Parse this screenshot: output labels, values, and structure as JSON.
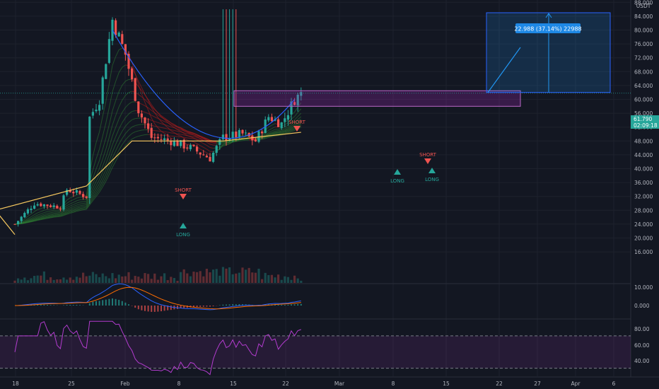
{
  "price_axis": {
    "currency": "USDT",
    "ticks": [
      "88.000",
      "84.000",
      "80.000",
      "76.000",
      "72.000",
      "68.000",
      "64.000",
      "60.000",
      "56.000",
      "52.000",
      "48.000",
      "44.000",
      "40.000",
      "36.000",
      "32.000",
      "28.000",
      "24.000",
      "20.000",
      "16.000"
    ]
  },
  "current_price": {
    "price": "61.790",
    "countdown": "02:09:18"
  },
  "macd_axis": {
    "ticks": [
      "10.000",
      "0.000"
    ]
  },
  "rsi_axis": {
    "ticks": [
      "80.00",
      "60.00",
      "40.00"
    ]
  },
  "time_axis": {
    "ticks": [
      "18",
      "25",
      "Feb",
      "8",
      "15",
      "22",
      "Mar",
      "8",
      "15",
      "22",
      "27",
      "Apr",
      "6"
    ]
  },
  "signals": [
    {
      "label": "SHORT",
      "kind": "short"
    },
    {
      "label": "LONG",
      "kind": "long"
    },
    {
      "label": "SHORT",
      "kind": "short"
    },
    {
      "label": "LONG",
      "kind": "long"
    },
    {
      "label": "SHORT",
      "kind": "short"
    },
    {
      "label": "LONG",
      "kind": "long"
    }
  ],
  "projection": {
    "label": "22.988 (37.14%) 22988"
  },
  "colors": {
    "bg": "#131722",
    "grid": "#1e222d",
    "text": "#b2b5be",
    "up": "#26a69a",
    "down": "#ef5350",
    "ma": "#f6c85f",
    "arc": "#2962ff",
    "box": "#9c27b0",
    "rsi": "#b43cd0",
    "macd": "#2962ff",
    "signal": "#ff6d00",
    "price_tag": "#26a69a",
    "projection": "#2196f3"
  },
  "chart_data": {
    "type": "candlestick",
    "symbol_quote": "USDT",
    "ylim": [
      14,
      92
    ],
    "price_path": [
      {
        "t": "Jan 18",
        "close": 24
      },
      {
        "t": "Jan 21",
        "close": 30
      },
      {
        "t": "Jan 25",
        "close": 29
      },
      {
        "t": "Jan 26",
        "close": 34
      },
      {
        "t": "Jan 29",
        "close": 32
      },
      {
        "t": "Feb 1",
        "close": 34
      },
      {
        "t": "Feb 5",
        "close": 35
      },
      {
        "t": "Feb 8",
        "close": 33
      },
      {
        "t": "Feb 10",
        "close": 44
      },
      {
        "t": "Feb 12",
        "close": 48
      },
      {
        "t": "Feb 15",
        "close": 53
      },
      {
        "t": "Feb 17",
        "close": 60
      },
      {
        "t": "Feb 19",
        "close": 83
      },
      {
        "t": "Feb 21",
        "close": 73
      },
      {
        "t": "Feb 23",
        "close": 57
      },
      {
        "t": "Feb 25",
        "close": 49
      },
      {
        "t": "Feb 28",
        "close": 48
      },
      {
        "t": "Mar 3",
        "close": 46
      },
      {
        "t": "Mar 6",
        "close": 43
      },
      {
        "t": "Mar 8",
        "close": 49
      },
      {
        "t": "Mar 11",
        "close": 50
      },
      {
        "t": "Mar 13",
        "close": 48
      },
      {
        "t": "Mar 15",
        "close": 55
      },
      {
        "t": "Mar 17",
        "close": 53
      },
      {
        "t": "Mar 19",
        "close": 60
      },
      {
        "t": "Mar 20",
        "close": 61.79
      }
    ],
    "moving_average": [
      {
        "t": "Jan 18",
        "value": 21
      },
      {
        "t": "Feb 1",
        "value": 28
      },
      {
        "t": "Feb 15",
        "value": 35
      },
      {
        "t": "Feb 22",
        "value": 48
      },
      {
        "t": "Mar 8",
        "value": 48
      },
      {
        "t": "Mar 20",
        "value": 50.5
      }
    ],
    "resistance_zone": [
      58,
      62.5
    ],
    "projection_range": [
      62,
      85
    ],
    "macd_range": [
      -5,
      10
    ],
    "rsi_range": [
      20,
      90
    ],
    "rsi_band": [
      30,
      70
    ]
  }
}
